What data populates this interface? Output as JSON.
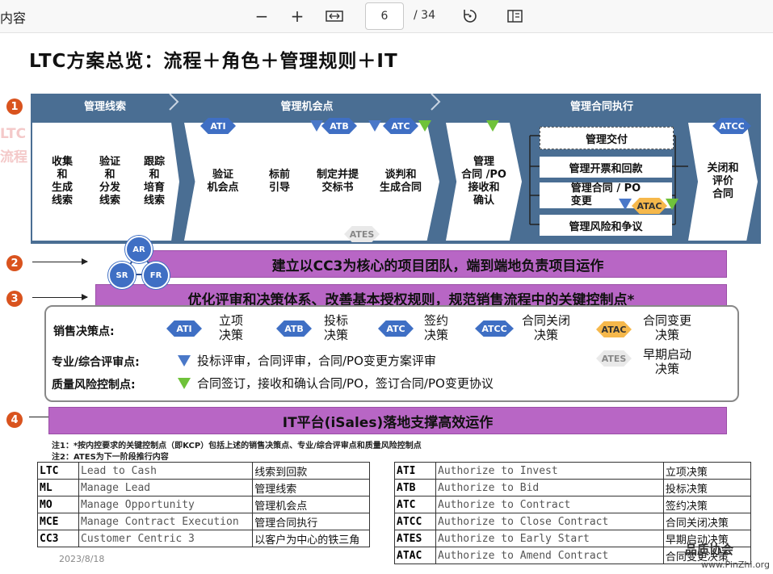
{
  "toolbar": {
    "title": "内容",
    "zoom_out": "−",
    "zoom_in": "+",
    "fit_icon": "fit-width-icon",
    "page_current": "6",
    "page_total": "/ 34",
    "rotate_icon": "rotate-icon",
    "view_icon": "page-view-icon"
  },
  "slide": {
    "title": "LTC方案总览：流程＋角色＋管理规则＋IT",
    "ghost_text": [
      "LTC",
      "流程"
    ],
    "numbers": [
      "1",
      "2",
      "3",
      "4"
    ],
    "headers": [
      "管理线索",
      "管理机会点",
      "管理合同执行"
    ],
    "steps": [
      "收集\n和\n生成\n线索",
      "验证\n和\n分发\n线索",
      "跟踪\n和\n培育\n线索",
      "验证\n机会点",
      "标前\n引导",
      "制定并提\n交标书",
      "谈判和\n生成合同",
      "管理\n合同 /PO\n接收和\n确认",
      "关闭和\n评价\n合同"
    ],
    "sub_steps": [
      "管理交付",
      "管理开票和回款",
      "管理合同 / PO\n变更",
      "管理风险和争议"
    ],
    "tags": {
      "ati": "ATI",
      "atb": "ATB",
      "atc": "ATC",
      "atcc": "ATCC",
      "ates": "ATES",
      "atac": "ATAC"
    },
    "roles": {
      "ar": "AR",
      "sr": "SR",
      "fr": "FR"
    },
    "bar2": "建立以CC3为核心的项目团队，端到端地负责项目运作",
    "bar3": "优化评审和决策体系、改善基本授权规则，规范销售流程中的关键控制点*",
    "bar4": "IT平台(iSales)落地支撑高效运作",
    "decision_label": "销售决策点:",
    "decisions": [
      "立项\n决策",
      "投标\n决策",
      "签约\n决策",
      "合同关闭\n决策",
      "合同变更\n决策",
      "早期启动\n决策"
    ],
    "review_label": "专业/综合评审点:",
    "review_text": "投标评审，合同评审，合同/PO变更方案评审",
    "quality_label": "质量风险控制点:",
    "quality_text": "合同签订，接收和确认合同/PO，签订合同/PO变更协议",
    "note1": "注1：*按内控要求的关键控制点（即KCP）包括上述的销售决策点、专业/综合评审点和质量风险控制点",
    "note2": "注2：ATES为下一阶段推行内容",
    "date": "2023/8/18",
    "watermark": "品质协会",
    "watermark_url": "www.PinZhi.org"
  },
  "abbr_left": [
    [
      "LTC",
      "Lead to Cash",
      "线索到回款"
    ],
    [
      "ML",
      "Manage Lead",
      "管理线索"
    ],
    [
      "MO",
      "Manage Opportunity",
      "管理机会点"
    ],
    [
      "MCE",
      "Manage Contract Execution",
      "管理合同执行"
    ],
    [
      "CC3",
      "Customer Centric 3",
      "以客户为中心的铁三角"
    ]
  ],
  "abbr_right": [
    [
      "ATI",
      "Authorize to Invest",
      "立项决策"
    ],
    [
      "ATB",
      "Authorize to Bid",
      "投标决策"
    ],
    [
      "ATC",
      "Authorize to Contract",
      "签约决策"
    ],
    [
      "ATCC",
      "Authorize to Close Contract",
      "合同关闭决策"
    ],
    [
      "ATES",
      "Authorize to Early Start",
      "早期启动决策"
    ],
    [
      "ATAC",
      "Authorize to Amend Contract",
      "合同变更决策"
    ]
  ],
  "colors": {
    "band": "#4a6e93",
    "bar": "#b866c5",
    "number": "#d9531e",
    "diamond": "#3f6fc4",
    "green": "#6fc23a"
  }
}
